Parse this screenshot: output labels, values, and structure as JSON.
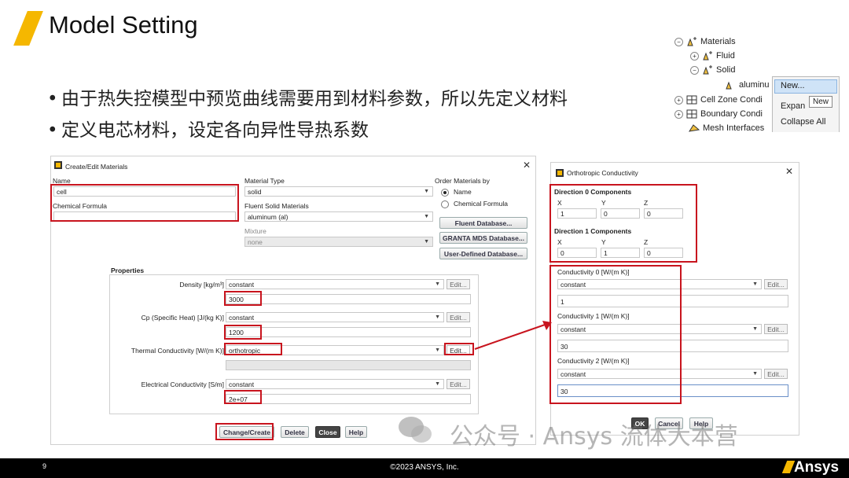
{
  "slide": {
    "title": "Model Setting",
    "bullets": [
      "由于热失控模型中预览曲线需要用到材料参数，所以先定义材料",
      "定义电芯材料，设定各向异性导热系数"
    ],
    "page_number": "9",
    "copyright": "©2023 ANSYS, Inc.",
    "brand": "Ansys",
    "watermark": "公众号 · Ansys 流体大本营"
  },
  "tree": {
    "items": [
      "Materials",
      "Fluid",
      "Solid",
      "aluminu",
      "Cell Zone Condi",
      "Boundary Condi",
      "Mesh Interfaces"
    ],
    "context_menu": [
      "New...",
      "Expan",
      "Collapse All"
    ],
    "tooltip": "New"
  },
  "materials_dialog": {
    "title": "Create/Edit Materials",
    "name_label": "Name",
    "name_value": "cell",
    "chem_label": "Chemical Formula",
    "material_type_label": "Material Type",
    "material_type_value": "solid",
    "fluent_solid_label": "Fluent Solid Materials",
    "fluent_solid_value": "aluminum (al)",
    "mixture_label": "Mixture",
    "mixture_value": "none",
    "order_label": "Order Materials by",
    "order_name": "Name",
    "order_chem": "Chemical Formula",
    "btn_fluent_db": "Fluent Database...",
    "btn_granta": "GRANTA MDS Database...",
    "btn_userdef": "User-Defined Database...",
    "properties_label": "Properties",
    "density_label": "Density [kg/m³]",
    "density_method": "constant",
    "density_value": "3000",
    "cp_label": "Cp (Specific Heat) [J/(kg K)]",
    "cp_method": "constant",
    "cp_value": "1200",
    "tc_label": "Thermal Conductivity [W/(m K)]",
    "tc_method": "orthotropic",
    "ec_label": "Electrical Conductivity [S/m]",
    "ec_method": "constant",
    "ec_value": "2e+07",
    "edit": "Edit...",
    "btn_change": "Change/Create",
    "btn_delete": "Delete",
    "btn_close": "Close",
    "btn_help": "Help"
  },
  "ortho_dialog": {
    "title": "Orthotropic Conductivity",
    "dir0_label": "Direction 0 Components",
    "dir1_label": "Direction 1 Components",
    "x": "X",
    "y": "Y",
    "z": "Z",
    "dir0": [
      "1",
      "0",
      "0"
    ],
    "dir1": [
      "0",
      "1",
      "0"
    ],
    "k0_label": "Conductivity 0 [W/(m K)]",
    "k1_label": "Conductivity 1 [W/(m K)]",
    "k2_label": "Conductivity 2 [W/(m K)]",
    "method": "constant",
    "k0": "1",
    "k1": "30",
    "k2": "30",
    "edit": "Edit...",
    "btn_ok": "OK",
    "btn_cancel": "Cancel",
    "btn_help": "Help"
  },
  "colors": {
    "accent": "#f5b700",
    "highlight": "#c8141e",
    "footer": "#000000"
  }
}
